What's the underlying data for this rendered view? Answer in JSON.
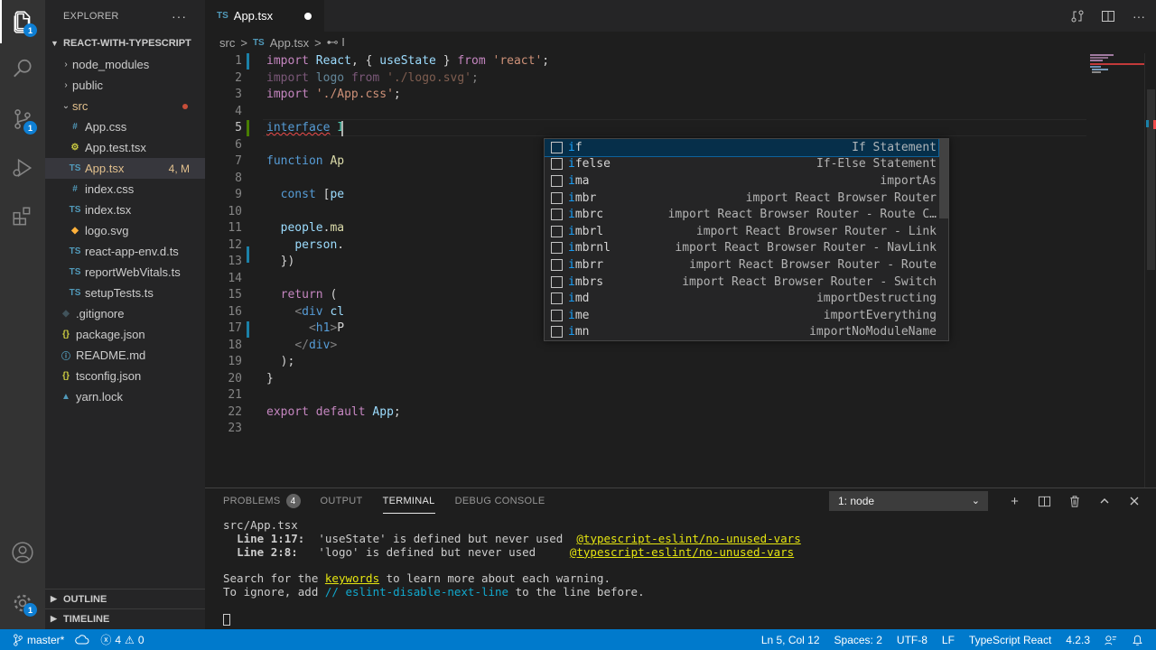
{
  "activity": {
    "explorer_badge": "1",
    "scm_badge": "1",
    "manage_badge": "1"
  },
  "sidebar": {
    "title": "EXPLORER",
    "more": "···",
    "project": "REACT-WITH-TYPESCRIPT",
    "items": [
      {
        "label": "node_modules",
        "type": "folder",
        "state": "collapsed"
      },
      {
        "label": "public",
        "type": "folder",
        "state": "collapsed"
      },
      {
        "label": "src",
        "type": "folder",
        "state": "expanded"
      },
      {
        "label": "App.css",
        "icon": "#",
        "color": "#519aba"
      },
      {
        "label": "App.test.tsx",
        "icon": "⚙",
        "color": "#cbcb41"
      },
      {
        "label": "App.tsx",
        "icon": "TS",
        "color": "#519aba",
        "badge": "4, M"
      },
      {
        "label": "index.css",
        "icon": "#",
        "color": "#519aba"
      },
      {
        "label": "index.tsx",
        "icon": "TS",
        "color": "#519aba"
      },
      {
        "label": "logo.svg",
        "icon": "◆",
        "color": "#ffb13b"
      },
      {
        "label": "react-app-env.d.ts",
        "icon": "TS",
        "color": "#519aba"
      },
      {
        "label": "reportWebVitals.ts",
        "icon": "TS",
        "color": "#519aba"
      },
      {
        "label": "setupTests.ts",
        "icon": "TS",
        "color": "#519aba"
      },
      {
        "label": ".gitignore",
        "icon": "◆",
        "color": "#41535b"
      },
      {
        "label": "package.json",
        "icon": "{}",
        "color": "#cbcb41"
      },
      {
        "label": "README.md",
        "icon": "ⓘ",
        "color": "#519aba"
      },
      {
        "label": "tsconfig.json",
        "icon": "{}",
        "color": "#cbcb41"
      },
      {
        "label": "yarn.lock",
        "icon": "▲",
        "color": "#519aba"
      }
    ],
    "outline": "OUTLINE",
    "timeline": "TIMELINE"
  },
  "editor": {
    "tab": {
      "badge": "TS",
      "label": "App.tsx"
    },
    "breadcrumb": {
      "folder": "src",
      "sep": ">",
      "badge": "TS",
      "file": "App.tsx",
      "symbol": "⊷ I"
    },
    "line_numbers": [
      "1",
      "2",
      "3",
      "4",
      "5",
      "6",
      "7",
      "8",
      "9",
      "10",
      "11",
      "12",
      "13",
      "14",
      "15",
      "16",
      "17",
      "18",
      "19",
      "20",
      "21",
      "22",
      "23"
    ]
  },
  "suggest": [
    {
      "match": "i",
      "rest": "f",
      "detail": "If Statement"
    },
    {
      "match": "i",
      "rest": "felse",
      "detail": "If-Else Statement"
    },
    {
      "match": "i",
      "rest": "ma",
      "detail": "importAs"
    },
    {
      "match": "i",
      "rest": "mbr",
      "detail": "import React Browser Router"
    },
    {
      "match": "i",
      "rest": "mbrc",
      "detail": "import React Browser Router - Route C…"
    },
    {
      "match": "i",
      "rest": "mbrl",
      "detail": "import React Browser Router - Link"
    },
    {
      "match": "i",
      "rest": "mbrnl",
      "detail": "import React Browser Router - NavLink"
    },
    {
      "match": "i",
      "rest": "mbrr",
      "detail": "import React Browser Router - Route"
    },
    {
      "match": "i",
      "rest": "mbrs",
      "detail": "import React Browser Router - Switch"
    },
    {
      "match": "i",
      "rest": "md",
      "detail": "importDestructing"
    },
    {
      "match": "i",
      "rest": "me",
      "detail": "importEverything"
    },
    {
      "match": "i",
      "rest": "mn",
      "detail": "importNoModuleName"
    }
  ],
  "panel": {
    "tabs": [
      "PROBLEMS",
      "OUTPUT",
      "TERMINAL",
      "DEBUG CONSOLE"
    ],
    "problems_count": "4",
    "terminal_select": "1: node",
    "terminal": {
      "file": "src/App.tsx",
      "w1_loc": "Line 1:17:",
      "w1_msg": "'useState' is defined but never used",
      "w1_rule": "@typescript-eslint/no-unused-vars",
      "w2_loc": "Line 2:8:",
      "w2_msg": "'logo' is defined but never used",
      "w2_rule": "@typescript-eslint/no-unused-vars",
      "search_pre": "Search for the ",
      "search_kw": "keywords",
      "search_post": " to learn more about each warning.",
      "ignore_pre": "To ignore, add ",
      "ignore_kw": "// eslint-disable-next-line",
      "ignore_post": " to the line before."
    }
  },
  "status": {
    "branch": "master*",
    "errors": "4",
    "warnings": "0",
    "position": "Ln 5, Col 12",
    "spaces": "Spaces: 2",
    "encoding": "UTF-8",
    "eol": "LF",
    "language": "TypeScript React",
    "version": "4.2.3"
  },
  "colors": {
    "accent": "#007acc",
    "activity_bg": "#333333",
    "sidebar_bg": "#252526",
    "editor_bg": "#1e1e1e"
  }
}
